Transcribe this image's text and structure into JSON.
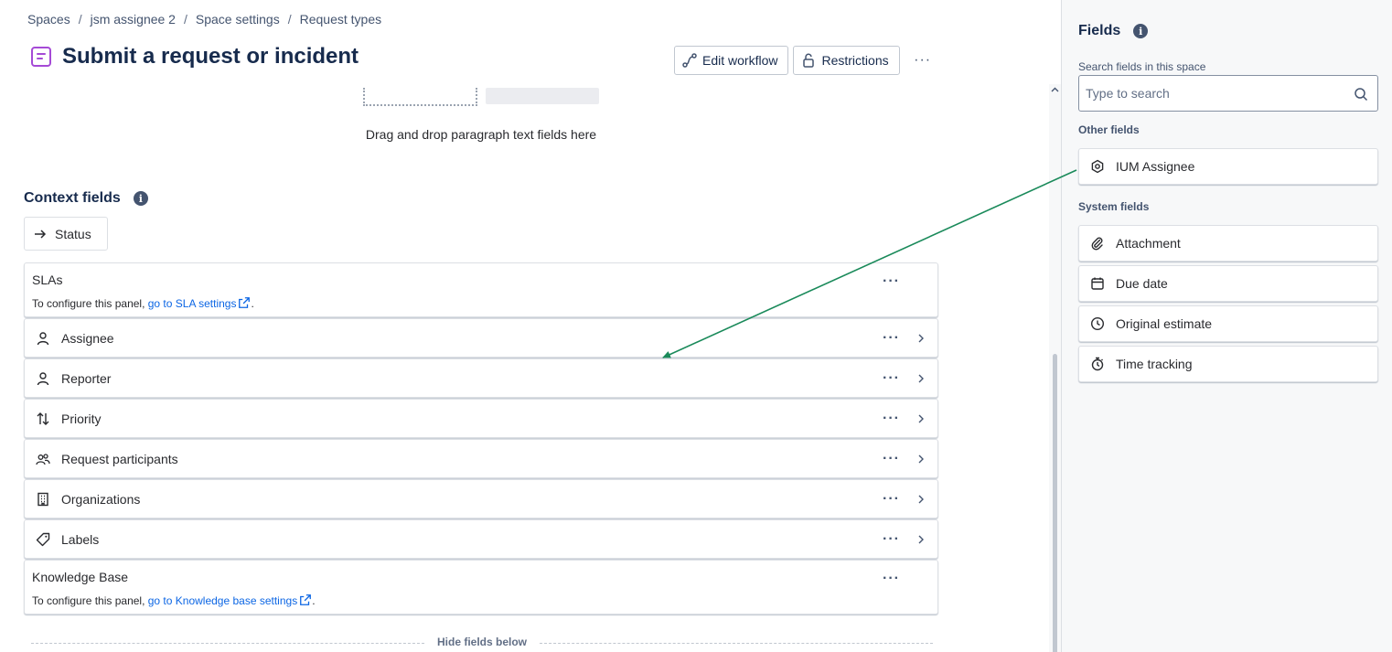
{
  "breadcrumb": [
    "Spaces",
    "jsm assignee 2",
    "Space settings",
    "Request types"
  ],
  "page_title": "Submit a request or incident",
  "actions": {
    "edit_workflow": "Edit workflow",
    "restrictions": "Restrictions",
    "more": "···"
  },
  "drop_zone_text": "Drag and drop paragraph text fields here",
  "context_fields": {
    "heading": "Context fields",
    "status_label": "Status",
    "sla": {
      "label": "SLAs",
      "desc_prefix": "To configure this panel, ",
      "link": "go to SLA settings",
      "suffix": "."
    },
    "rows": [
      {
        "label": "Assignee",
        "icon": "person-icon"
      },
      {
        "label": "Reporter",
        "icon": "person-icon"
      },
      {
        "label": "Priority",
        "icon": "priority-icon"
      },
      {
        "label": "Request participants",
        "icon": "people-icon"
      },
      {
        "label": "Organizations",
        "icon": "building-icon"
      },
      {
        "label": "Labels",
        "icon": "tag-icon"
      }
    ],
    "kb": {
      "label": "Knowledge Base",
      "desc_prefix": "To configure this panel, ",
      "link": "go to Knowledge base settings",
      "suffix": "."
    },
    "hide_below": "Hide fields below"
  },
  "sidebar": {
    "title": "Fields",
    "search_label": "Search fields in this space",
    "search_placeholder": "Type to search",
    "other_heading": "Other fields",
    "other_fields": [
      {
        "label": "IUM Assignee",
        "icon": "hexagon-icon"
      }
    ],
    "system_heading": "System fields",
    "system_fields": [
      {
        "label": "Attachment",
        "icon": "paperclip-icon"
      },
      {
        "label": "Due date",
        "icon": "calendar-icon"
      },
      {
        "label": "Original estimate",
        "icon": "clock-icon"
      },
      {
        "label": "Time tracking",
        "icon": "stopwatch-icon"
      }
    ]
  },
  "colors": {
    "arrow": "#1a8a5a",
    "link": "#0c66e4",
    "title_icon": "#a54ad6"
  }
}
